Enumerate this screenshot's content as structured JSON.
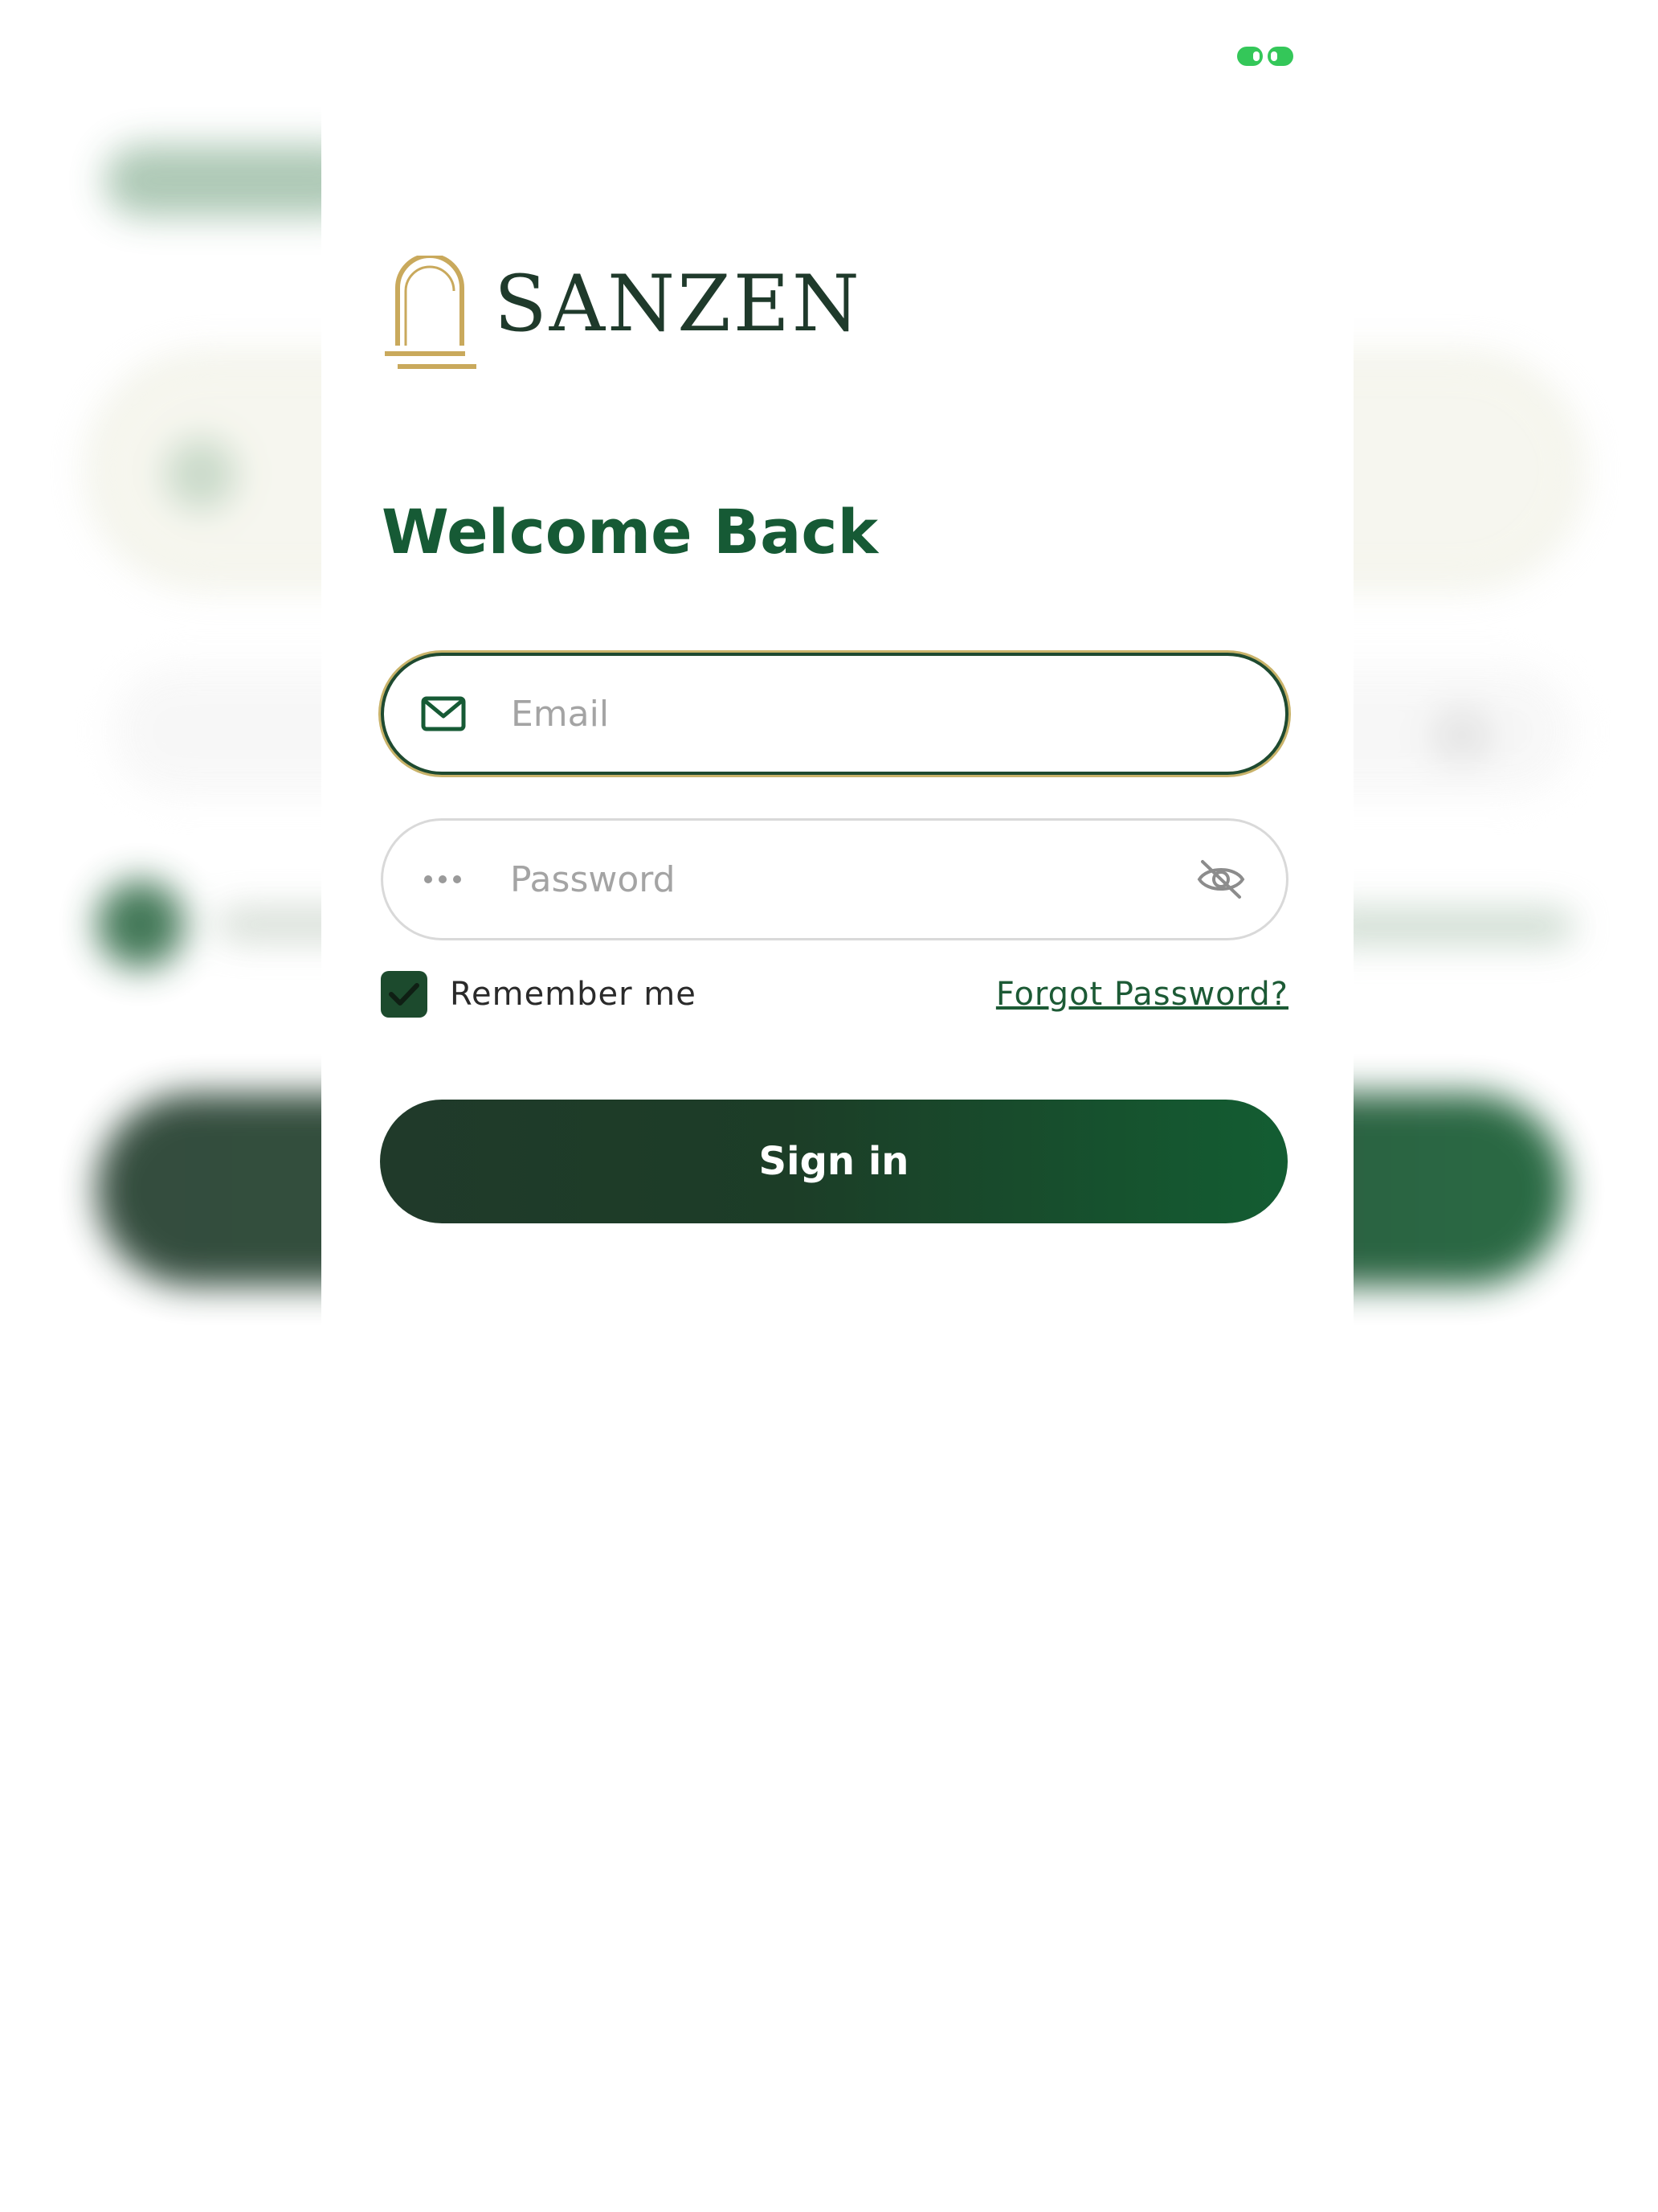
{
  "brand": {
    "name": "SANZEN",
    "text_color": "#1f3a2b",
    "mark_color": "#c9a95c"
  },
  "login": {
    "title": "Welcome Back",
    "email": {
      "value": "",
      "placeholder": "Email",
      "icon": "mail-icon"
    },
    "password": {
      "value": "",
      "placeholder": "Password",
      "icon": "dots-icon",
      "toggle_icon": "eye-off-icon"
    },
    "remember_me": {
      "label": "Remember me",
      "checked": true
    },
    "forgot_password": "Forgot Password?",
    "submit_label": "Sign in"
  },
  "status": {
    "loader_icon": "loading-indicator-icon",
    "loader_color": "#34c759"
  },
  "colors": {
    "primary": "#165a35",
    "primary_dark": "#1f3a2a",
    "accent_gold": "#c9b36a",
    "placeholder": "#a4a4a4"
  }
}
